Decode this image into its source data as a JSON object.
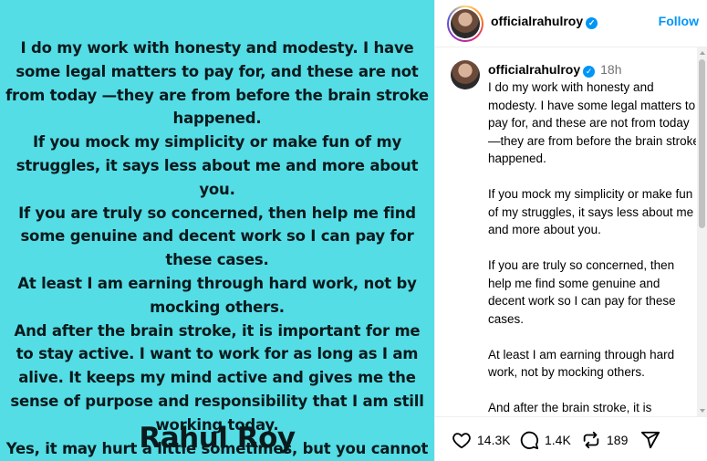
{
  "post_image": {
    "paragraphs": [
      "I do my work with honesty and modesty. I have some legal matters to pay for, and these are not from today —they are from before the brain stroke happened.",
      "If you mock my simplicity or make fun of my struggles, it says less about me and more about you.",
      "If you are truly so concerned, then help me find some genuine and decent work so I can pay for these cases.",
      "At least I am earning through hard work, not by mocking others.",
      "And after the brain stroke, it is important for me to stay active. I want to work for as long as I am alive. It keeps my mind active and gives me the sense of purpose and responsibility that I am still working today.",
      "Yes, it may hurt a little sometimes, but you cannot break me."
    ],
    "signature": "Rahul Roy",
    "background_color": "#55dde6"
  },
  "header": {
    "username": "officialrahulroy",
    "follow_label": "Follow"
  },
  "caption": {
    "username": "officialrahulroy",
    "time": "18h",
    "paragraphs": [
      "I do my work with honesty and modesty. I have some legal matters to pay for, and these are not from today —they are from before the brain stroke happened.",
      "If you mock my simplicity or make fun of my struggles, it says less about me and more about you.",
      "If you are truly so concerned, then help me find some genuine and decent work so I can pay for these cases.",
      "At least I am earning through hard work, not by mocking others.",
      "And after the brain stroke, it is important for me to stay active. I want to work for as long as I am alive. It"
    ]
  },
  "actions": {
    "likes": "14.3K",
    "comments": "1.4K",
    "reposts": "189",
    "icons": [
      "heart-icon",
      "comment-icon",
      "repost-icon",
      "share-icon"
    ]
  },
  "colors": {
    "accent": "#0095f6",
    "muted": "#737373"
  }
}
